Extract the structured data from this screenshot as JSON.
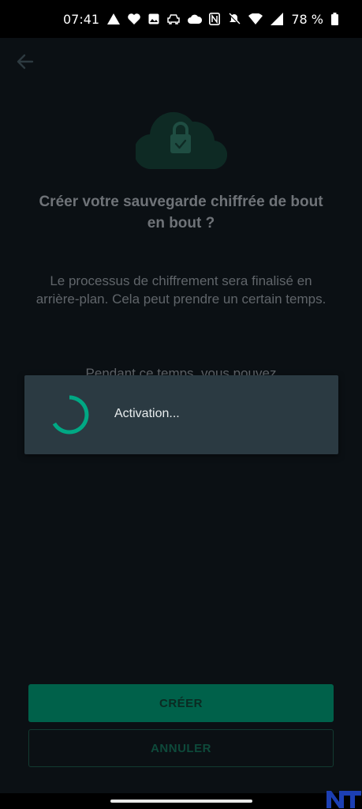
{
  "status_bar": {
    "time": "07:41",
    "battery": "78 %",
    "icons_left": [
      "navigation-icon",
      "heart-icon",
      "image-icon",
      "car-icon",
      "cloud-icon"
    ],
    "icons_right": [
      "nfc-icon",
      "mute-icon",
      "wifi-icon",
      "signal-icon",
      "battery-icon"
    ]
  },
  "header": {
    "back_icon": "arrow-left-icon"
  },
  "main": {
    "title": "Créer votre sauvegarde chiffrée de bout en bout ?",
    "body": "Le processus de chiffrement sera finalisé en arrière-plan. Cela peut prendre un certain temps.",
    "body_cut": "Pendant ce temps, vous pouvez"
  },
  "dialog": {
    "text": "Activation..."
  },
  "buttons": {
    "create": "CRÉER",
    "cancel": "ANNULER"
  },
  "colors": {
    "background": "#0b1014",
    "accent": "#00a884",
    "dialog": "#2b3a42",
    "primary_button": "#00614a"
  }
}
